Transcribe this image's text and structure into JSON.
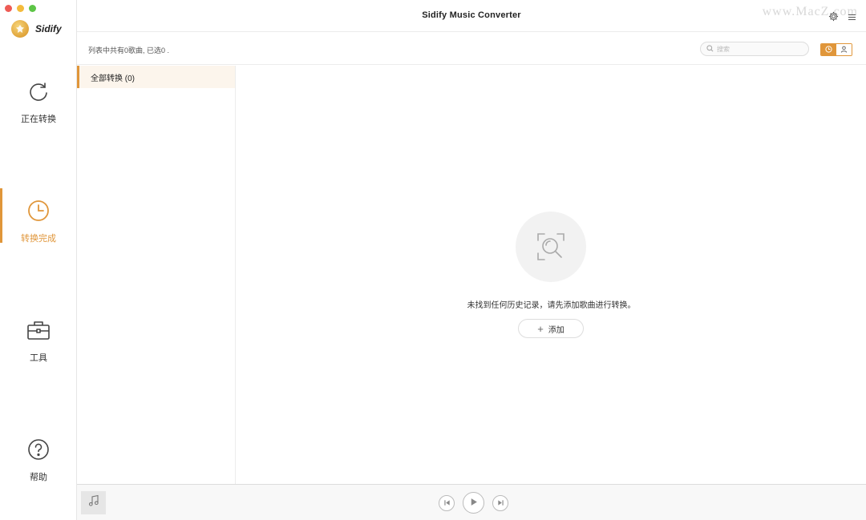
{
  "window": {
    "title": "Sidify Music Converter",
    "watermark": "www.MacZ.com"
  },
  "brand": {
    "name": "Sidify",
    "accent_color": "#e0963a"
  },
  "sidebar": {
    "items": [
      {
        "label": "正在转换",
        "icon": "refresh-icon",
        "active": false
      },
      {
        "label": "转换完成",
        "icon": "clock-icon",
        "active": true
      },
      {
        "label": "工具",
        "icon": "toolbox-icon",
        "active": false
      },
      {
        "label": "帮助",
        "icon": "help-icon",
        "active": false
      }
    ]
  },
  "toolbar": {
    "status": "列表中共有0歌曲, 已选0 .",
    "search_placeholder": "搜索",
    "view_toggle": [
      {
        "icon": "history-icon",
        "active": true
      },
      {
        "icon": "user-icon",
        "active": false
      }
    ]
  },
  "categories": [
    {
      "label": "全部转换 (0)",
      "active": true
    }
  ],
  "empty_state": {
    "icon": "search-icon",
    "message": "未找到任何历史记录，请先添加歌曲进行转换。",
    "add_label": "添加"
  },
  "player": {
    "controls": [
      "previous-icon",
      "play-icon",
      "next-icon"
    ]
  }
}
